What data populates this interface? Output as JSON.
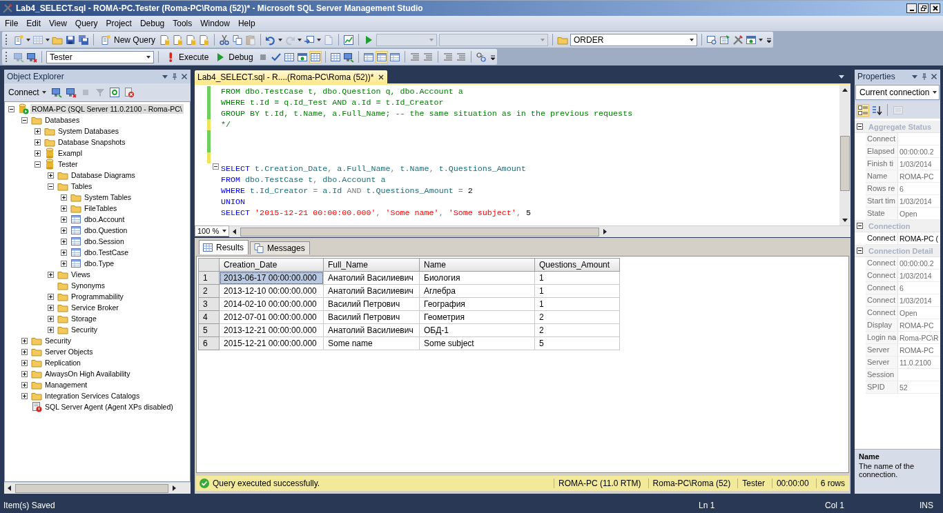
{
  "window": {
    "title": "Lab4_SELECT.sql - ROMA-PC.Tester (Roma-PC\\Roma (52))* - Microsoft SQL Server Management Studio"
  },
  "menu": [
    "File",
    "Edit",
    "View",
    "Query",
    "Project",
    "Debug",
    "Tools",
    "Window",
    "Help"
  ],
  "toolbar": {
    "new_query": "New Query",
    "solution_combo": {
      "disabled": true
    },
    "config_combo": {
      "disabled": true
    },
    "find_combo": {
      "value": "ORDER"
    },
    "database_combo": {
      "value": "Tester"
    },
    "execute": "Execute",
    "debug": "Debug"
  },
  "object_explorer": {
    "title": "Object Explorer",
    "connect": "Connect",
    "tree": [
      {
        "label": "ROMA-PC (SQL Server 11.0.2100 - Roma-PC\\",
        "kind": "server",
        "expandable": true,
        "expanded": true,
        "selected": true,
        "children": [
          {
            "label": "Databases",
            "kind": "folder",
            "expandable": true,
            "expanded": true,
            "selected": false,
            "children": [
              {
                "label": "System Databases",
                "kind": "folder",
                "expandable": true,
                "expanded": false,
                "selected": false
              },
              {
                "label": "Database Snapshots",
                "kind": "folder",
                "expandable": true,
                "expanded": false,
                "selected": false
              },
              {
                "label": "Exampl",
                "kind": "database",
                "expandable": true,
                "expanded": false,
                "selected": false
              },
              {
                "label": "Tester",
                "kind": "database",
                "expandable": true,
                "expanded": true,
                "selected": false,
                "children": [
                  {
                    "label": "Database Diagrams",
                    "kind": "folder",
                    "expandable": true,
                    "expanded": false,
                    "selected": false
                  },
                  {
                    "label": "Tables",
                    "kind": "folder",
                    "expandable": true,
                    "expanded": true,
                    "selected": false,
                    "children": [
                      {
                        "label": "System Tables",
                        "kind": "folder",
                        "expandable": true,
                        "expanded": false,
                        "selected": false
                      },
                      {
                        "label": "FileTables",
                        "kind": "folder",
                        "expandable": true,
                        "expanded": false,
                        "selected": false
                      },
                      {
                        "label": "dbo.Account",
                        "kind": "table",
                        "expandable": true,
                        "expanded": false,
                        "selected": false
                      },
                      {
                        "label": "dbo.Question",
                        "kind": "table",
                        "expandable": true,
                        "expanded": false,
                        "selected": false
                      },
                      {
                        "label": "dbo.Session",
                        "kind": "table",
                        "expandable": true,
                        "expanded": false,
                        "selected": false
                      },
                      {
                        "label": "dbo.TestCase",
                        "kind": "table",
                        "expandable": true,
                        "expanded": false,
                        "selected": false
                      },
                      {
                        "label": "dbo.Type",
                        "kind": "table",
                        "expandable": true,
                        "expanded": false,
                        "selected": false
                      }
                    ]
                  },
                  {
                    "label": "Views",
                    "kind": "folder",
                    "expandable": true,
                    "expanded": false,
                    "selected": false
                  },
                  {
                    "label": "Synonyms",
                    "kind": "folder",
                    "expandable": false,
                    "expanded": false,
                    "selected": false
                  },
                  {
                    "label": "Programmability",
                    "kind": "folder",
                    "expandable": true,
                    "expanded": false,
                    "selected": false
                  },
                  {
                    "label": "Service Broker",
                    "kind": "folder",
                    "expandable": true,
                    "expanded": false,
                    "selected": false
                  },
                  {
                    "label": "Storage",
                    "kind": "folder",
                    "expandable": true,
                    "expanded": false,
                    "selected": false
                  },
                  {
                    "label": "Security",
                    "kind": "folder",
                    "expandable": true,
                    "expanded": false,
                    "selected": false
                  }
                ]
              }
            ]
          },
          {
            "label": "Security",
            "kind": "folder",
            "expandable": true,
            "expanded": false,
            "selected": false
          },
          {
            "label": "Server Objects",
            "kind": "folder",
            "expandable": true,
            "expanded": false,
            "selected": false
          },
          {
            "label": "Replication",
            "kind": "folder",
            "expandable": true,
            "expanded": false,
            "selected": false
          },
          {
            "label": "AlwaysOn High Availability",
            "kind": "folder",
            "expandable": true,
            "expanded": false,
            "selected": false
          },
          {
            "label": "Management",
            "kind": "folder",
            "expandable": true,
            "expanded": false,
            "selected": false
          },
          {
            "label": "Integration Services Catalogs",
            "kind": "folder",
            "expandable": true,
            "expanded": false,
            "selected": false
          },
          {
            "label": "SQL Server Agent (Agent XPs disabled)",
            "kind": "agent",
            "expandable": false,
            "expanded": false,
            "selected": false
          }
        ]
      }
    ]
  },
  "editor": {
    "tab": {
      "label": "Lab4_SELECT.sql - R....(Roma-PC\\Roma (52))*",
      "selected": true
    },
    "zoom": "100 %",
    "lines": [
      {
        "modified": true,
        "saved": true,
        "fold": false,
        "tokens": [
          {
            "text": "FROM dbo.TestCase t, dbo.Question q, dbo.Account a",
            "kind": "comment"
          }
        ]
      },
      {
        "modified": true,
        "saved": true,
        "fold": false,
        "tokens": [
          {
            "text": "WHERE t.Id = q.Id_Test AND a.Id = t.Id_Creator",
            "kind": "comment"
          }
        ]
      },
      {
        "modified": true,
        "saved": true,
        "fold": false,
        "tokens": [
          {
            "text": "GROUP BY t.Id, t.Name, a.Full_Name; -- the same situation as in the previous requests",
            "kind": "comment"
          }
        ]
      },
      {
        "modified": true,
        "saved": false,
        "fold": false,
        "tokens": [
          {
            "text": "*/",
            "kind": "comment"
          }
        ]
      },
      {
        "modified": true,
        "saved": true,
        "fold": false
      },
      {
        "modified": true,
        "saved": true,
        "fold": false
      },
      {
        "modified": true,
        "saved": false,
        "fold": false
      },
      {
        "modified": false,
        "fold": true,
        "tokens": [
          {
            "text": "SELECT",
            "kind": "keyword"
          },
          {
            "text": " t.Creation_Date",
            "kind": "ident"
          },
          {
            "text": ",",
            "kind": "op"
          },
          {
            "text": " a.Full_Name",
            "kind": "ident"
          },
          {
            "text": ",",
            "kind": "op"
          },
          {
            "text": " t.Name",
            "kind": "ident"
          },
          {
            "text": ",",
            "kind": "op"
          },
          {
            "text": " t.Questions_Amount",
            "kind": "ident"
          }
        ]
      },
      {
        "modified": false,
        "fold": false,
        "tokens": [
          {
            "text": "FROM",
            "kind": "keyword"
          },
          {
            "text": " dbo.TestCase t",
            "kind": "ident"
          },
          {
            "text": ",",
            "kind": "op"
          },
          {
            "text": " dbo.Account a",
            "kind": "ident"
          }
        ]
      },
      {
        "modified": false,
        "fold": false,
        "tokens": [
          {
            "text": "WHERE",
            "kind": "keyword"
          },
          {
            "text": " t.Id_Creator ",
            "kind": "ident"
          },
          {
            "text": "=",
            "kind": "op"
          },
          {
            "text": " a.Id ",
            "kind": "ident"
          },
          {
            "text": "AND",
            "kind": "op"
          },
          {
            "text": " t.Questions_Amount ",
            "kind": "ident"
          },
          {
            "text": "=",
            "kind": "op"
          },
          {
            "text": " 2",
            "kind": "number"
          }
        ]
      },
      {
        "modified": false,
        "fold": false,
        "tokens": [
          {
            "text": "UNION",
            "kind": "keyword"
          }
        ]
      },
      {
        "modified": false,
        "fold": false,
        "tokens": [
          {
            "text": "SELECT",
            "kind": "keyword"
          },
          {
            "text": " '2015-12-21 00:00:00.000'",
            "kind": "string"
          },
          {
            "text": ",",
            "kind": "op"
          },
          {
            "text": " 'Some name'",
            "kind": "string"
          },
          {
            "text": ",",
            "kind": "op"
          },
          {
            "text": " 'Some subject'",
            "kind": "string"
          },
          {
            "text": ",",
            "kind": "op"
          },
          {
            "text": " 5",
            "kind": "number"
          }
        ]
      }
    ]
  },
  "results": {
    "tabs": [
      {
        "label": "Results",
        "selected": true
      },
      {
        "label": "Messages",
        "selected": false
      }
    ],
    "columns": [
      "Creation_Date",
      "Full_Name",
      "Name",
      "Questions_Amount"
    ],
    "rows": [
      {
        "number": "1",
        "cells": [
          {
            "text": "2013-06-17 00:00:00.000",
            "selected": true
          },
          {
            "text": "Анатолий Василиевич",
            "selected": false
          },
          {
            "text": "Биология",
            "selected": false
          },
          {
            "text": "1",
            "selected": false
          }
        ]
      },
      {
        "number": "2",
        "cells": [
          {
            "text": "2013-12-10 00:00:00.000",
            "selected": false
          },
          {
            "text": "Анатолий Василиевич",
            "selected": false
          },
          {
            "text": "Аглебра",
            "selected": false
          },
          {
            "text": "1",
            "selected": false
          }
        ]
      },
      {
        "number": "3",
        "cells": [
          {
            "text": "2014-02-10 00:00:00.000",
            "selected": false
          },
          {
            "text": "Василий Петрович",
            "selected": false
          },
          {
            "text": "География",
            "selected": false
          },
          {
            "text": "1",
            "selected": false
          }
        ]
      },
      {
        "number": "4",
        "cells": [
          {
            "text": "2012-07-01 00:00:00.000",
            "selected": false
          },
          {
            "text": "Василий Петрович",
            "selected": false
          },
          {
            "text": "Геометрия",
            "selected": false
          },
          {
            "text": "2",
            "selected": false
          }
        ]
      },
      {
        "number": "5",
        "cells": [
          {
            "text": "2013-12-21 00:00:00.000",
            "selected": false
          },
          {
            "text": "Анатолий Василиевич",
            "selected": false
          },
          {
            "text": "ОБД-1",
            "selected": false
          },
          {
            "text": "2",
            "selected": false
          }
        ]
      },
      {
        "number": "6",
        "cells": [
          {
            "text": "2015-12-21 00:00:00.000",
            "selected": false
          },
          {
            "text": "Some name",
            "selected": false
          },
          {
            "text": "Some subject",
            "selected": false
          },
          {
            "text": "5",
            "selected": false
          }
        ]
      }
    ],
    "status": {
      "message": "Query executed successfully.",
      "segments": [
        "ROMA-PC (11.0 RTM)",
        "Roma-PC\\Roma (52)",
        "Tester",
        "00:00:00",
        "6 rows"
      ]
    }
  },
  "properties": {
    "title": "Properties",
    "object": "Current connection",
    "categories": [
      {
        "title": "Aggregate Status",
        "expanded": true,
        "rows": [
          {
            "name": "Connect",
            "selected": false
          },
          {
            "name": "Elapsed",
            "value": "00:00:00.2",
            "selected": false
          },
          {
            "name": "Finish ti",
            "value": "1/03/2014",
            "selected": false
          },
          {
            "name": "Name",
            "value": "ROMA-PC",
            "selected": false
          },
          {
            "name": "Rows re",
            "value": "6",
            "selected": false
          },
          {
            "name": "Start tim",
            "value": "1/03/2014",
            "selected": false
          },
          {
            "name": "State",
            "value": "Open",
            "selected": false
          }
        ]
      },
      {
        "title": "Connection",
        "expanded": true,
        "rows": [
          {
            "name": "Connect",
            "value": "ROMA-PC (",
            "selected": true
          }
        ]
      },
      {
        "title": "Connection Detail",
        "expanded": true,
        "rows": [
          {
            "name": "Connect",
            "value": "00:00:00.2",
            "selected": false
          },
          {
            "name": "Connect",
            "value": "1/03/2014",
            "selected": false
          },
          {
            "name": "Connect",
            "value": "6",
            "selected": false
          },
          {
            "name": "Connect",
            "value": "1/03/2014",
            "selected": false
          },
          {
            "name": "Connect",
            "value": "Open",
            "selected": false
          },
          {
            "name": "Display",
            "value": "ROMA-PC",
            "selected": false
          },
          {
            "name": "Login na",
            "value": "Roma-PC\\R",
            "selected": false
          },
          {
            "name": "Server",
            "value": "ROMA-PC",
            "selected": false
          },
          {
            "name": "Server",
            "value": "11.0.2100",
            "selected": false
          },
          {
            "name": "Session",
            "selected": false
          },
          {
            "name": "SPID",
            "value": "52",
            "selected": false
          }
        ]
      }
    ],
    "description": {
      "title": "Name",
      "text": "The name of the connection."
    }
  },
  "status_bar": {
    "message": "Item(s) Saved",
    "line": "Ln 1",
    "column": "Col 1",
    "mode": "INS"
  }
}
